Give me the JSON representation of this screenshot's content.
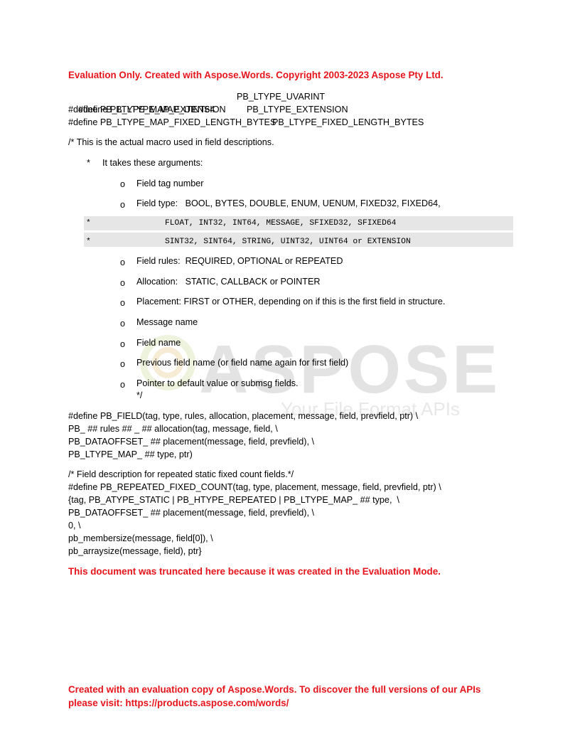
{
  "header_notice": "Evaluation Only. Created with Aspose.Words. Copyright 2003-2023 Aspose Pty Ltd.",
  "defines": [
    {
      "left": "#define PB_LTYPE_MAP_UINT64",
      "right": "PB_LTYPE_UVARINT"
    },
    {
      "left": "#define PB_LTYPE_MAP_EXTENSION",
      "right": "PB_LTYPE_EXTENSION"
    },
    {
      "left": "#define PB_LTYPE_MAP_FIXED_LENGTH_BYTES",
      "right": "PB_LTYPE_FIXED_LENGTH_BYTES"
    }
  ],
  "comment_intro": "/* This is the actual macro used in field descriptions.",
  "star_bullet": "*",
  "takes_args": "It takes these arguments:",
  "args": {
    "field_tag": "Field tag number",
    "field_type": "Field type:   BOOL, BYTES, DOUBLE, ENUM, UENUM, FIXED32, FIXED64,",
    "mono_line_1": "FLOAT, INT32, INT64, MESSAGE, SFIXED32, SFIXED64",
    "mono_line_2": "SINT32, SINT64, STRING, UINT32, UINT64 or EXTENSION",
    "field_rules": "Field rules:  REQUIRED, OPTIONAL or REPEATED",
    "allocation": "Allocation:   STATIC, CALLBACK or POINTER",
    "placement": "Placement: FIRST or OTHER, depending on if this is the first field in structure.",
    "message_name": "Message name",
    "field_name": "Field name",
    "previous_field": "Previous field name (or field name again for first field)",
    "pointer_default": "Pointer to default value or submsg fields.",
    "comment_close": "*/"
  },
  "bullet_o": "o",
  "pb_field_block": [
    "#define PB_FIELD(tag, type, rules, allocation, placement, message, field, prevfield, ptr) \\",
    "PB_ ## rules ## _ ## allocation(tag, message, field, \\",
    "PB_DATAOFFSET_ ## placement(message, field, prevfield), \\",
    "PB_LTYPE_MAP_ ## type, ptr)"
  ],
  "repeated_block": [
    "/* Field description for repeated static fixed count fields.*/",
    "#define PB_REPEATED_FIXED_COUNT(tag, type, placement, message, field, prevfield, ptr) \\",
    "{tag, PB_ATYPE_STATIC | PB_HTYPE_REPEATED | PB_LTYPE_MAP_ ## type,  \\",
    "PB_DATAOFFSET_ ## placement(message, field, prevfield), \\",
    "0, \\",
    "pb_membersize(message, field[0]), \\",
    "pb_arraysize(message, field), ptr}"
  ],
  "truncated_notice": "This document was truncated here because it was created in the Evaluation Mode.",
  "footer_notice_1": "Created with an evaluation copy of Aspose.Words. To discover the full versions of our APIs",
  "footer_notice_2": "please visit: https://products.aspose.com/words/",
  "watermark": {
    "logo_text": "ASPOSE",
    "tagline": "Your File Format APIs"
  },
  "colors": {
    "notice_red": "#e8141c",
    "band_gray": "#e6e6e6"
  }
}
